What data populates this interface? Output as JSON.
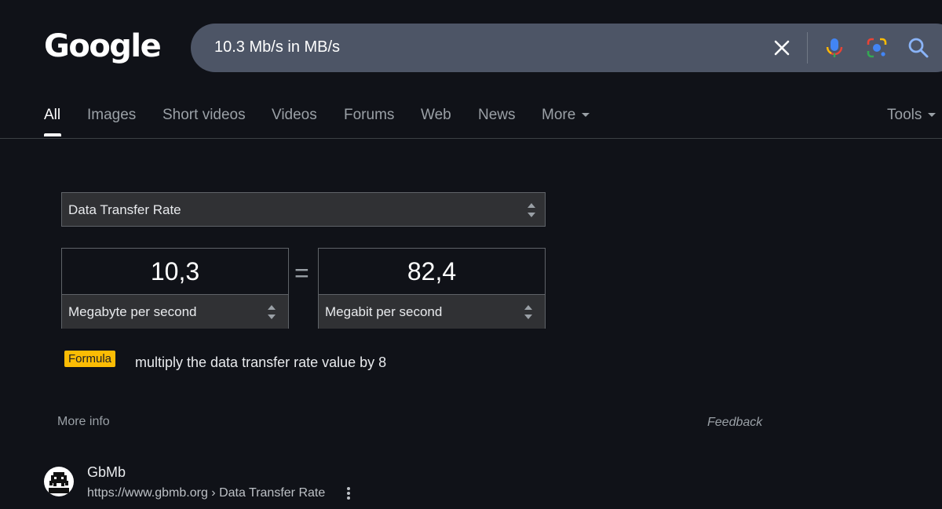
{
  "logo": {
    "text": "Google"
  },
  "search": {
    "query": "10.3 Mb/s in MB/s"
  },
  "tabs": [
    {
      "label": "All",
      "active": true
    },
    {
      "label": "Images"
    },
    {
      "label": "Short videos"
    },
    {
      "label": "Videos"
    },
    {
      "label": "Forums"
    },
    {
      "label": "Web"
    },
    {
      "label": "News"
    },
    {
      "label": "More"
    }
  ],
  "tools": {
    "label": "Tools"
  },
  "converter": {
    "category": "Data Transfer Rate",
    "left": {
      "value": "10,3",
      "unit": "Megabyte per second"
    },
    "equals": "=",
    "right": {
      "value": "82,4",
      "unit": "Megabit per second"
    },
    "formula_label": "Formula",
    "formula_text": "multiply the data transfer rate value by 8"
  },
  "more_info": "More info",
  "feedback": "Feedback",
  "result": {
    "site_name": "GbMb",
    "url": "https://www.gbmb.org › Data Transfer Rate"
  },
  "colors": {
    "background": "#101218",
    "searchbar": "#4d5566",
    "formula_badge": "#fbbc04"
  }
}
